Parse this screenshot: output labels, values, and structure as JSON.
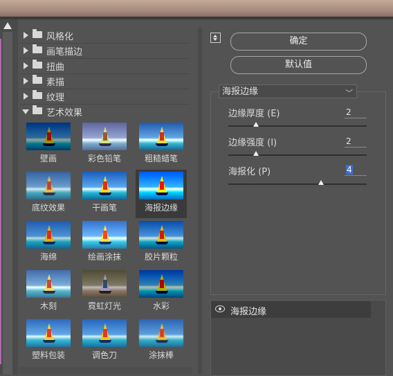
{
  "categories": [
    {
      "label": "风格化",
      "open": false
    },
    {
      "label": "画笔描边",
      "open": false
    },
    {
      "label": "扭曲",
      "open": false
    },
    {
      "label": "素描",
      "open": false
    },
    {
      "label": "纹理",
      "open": false
    },
    {
      "label": "艺术效果",
      "open": true
    }
  ],
  "filters": [
    {
      "label": "壁画"
    },
    {
      "label": "彩色铅笔"
    },
    {
      "label": "粗糙蜡笔"
    },
    {
      "label": "底纹效果"
    },
    {
      "label": "干画笔"
    },
    {
      "label": "海报边缘",
      "selected": true
    },
    {
      "label": "海绵"
    },
    {
      "label": "绘画涂抹"
    },
    {
      "label": "胶片颗粒"
    },
    {
      "label": "木刻"
    },
    {
      "label": "霓虹灯光"
    },
    {
      "label": "水彩"
    },
    {
      "label": "塑料包装"
    },
    {
      "label": "调色刀"
    },
    {
      "label": "涂抹棒"
    }
  ],
  "buttons": {
    "ok": "确定",
    "default": "默认值"
  },
  "effect_select": {
    "value": "海报边缘"
  },
  "params": [
    {
      "label": "边缘厚度 (E)",
      "value": "2",
      "level": 0.2
    },
    {
      "label": "边缘强度 (I)",
      "value": "2",
      "level": 0.2
    },
    {
      "label": "海报化 (P)",
      "value": "4",
      "level": 0.67,
      "active": true
    }
  ],
  "layers": [
    {
      "label": "海报边缘",
      "icon": "eye-icon"
    }
  ],
  "colors": {
    "panel": "#535353",
    "highlight": "#3b6fc8",
    "selected_thumb": "#3a3a3a"
  }
}
